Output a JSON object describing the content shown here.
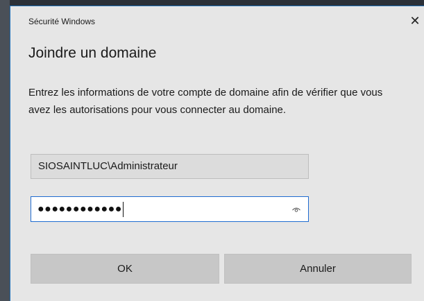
{
  "window": {
    "title": "Sécurité Windows",
    "close_glyph": "✕"
  },
  "dialog": {
    "heading": "Joindre un domaine",
    "description": "Entrez les informations de votre compte de domaine afin de vérifier que vous avez les autorisations pour vous connecter au domaine."
  },
  "form": {
    "username_value": "SIOSAINTLUC\\Administrateur",
    "password_mask": "●●●●●●●●●●●●",
    "reveal_icon": "eye-icon"
  },
  "buttons": {
    "ok_label": "OK",
    "cancel_label": "Annuler"
  },
  "colors": {
    "accent": "#1e6bd0",
    "dialog_bg": "#e6e6e6",
    "button_bg": "#c7c7c7"
  }
}
